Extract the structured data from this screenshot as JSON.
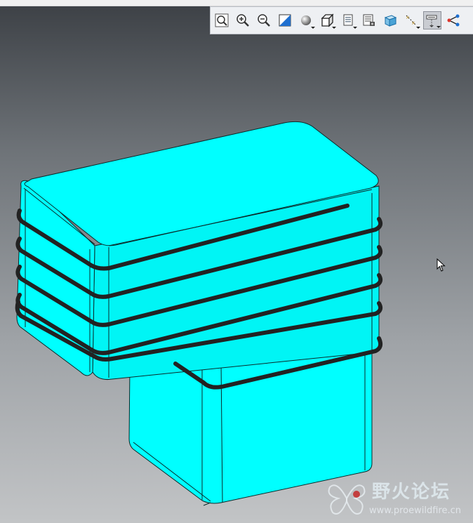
{
  "toolbar": {
    "buttons": [
      {
        "icon": "zoom-fit-icon",
        "active": false,
        "dropdown": false
      },
      {
        "icon": "zoom-in-icon",
        "active": false,
        "dropdown": false
      },
      {
        "icon": "zoom-out-icon",
        "active": false,
        "dropdown": false
      },
      {
        "icon": "repaint-icon",
        "active": false,
        "dropdown": false
      },
      {
        "icon": "shading-icon",
        "active": false,
        "dropdown": true
      },
      {
        "icon": "view-orientation-icon",
        "active": false,
        "dropdown": true
      },
      {
        "icon": "saved-views-icon",
        "active": false,
        "dropdown": true
      },
      {
        "icon": "view-manager-icon",
        "active": false,
        "dropdown": false
      },
      {
        "icon": "perspective-view-icon",
        "active": false,
        "dropdown": false
      },
      {
        "icon": "datum-display-icon",
        "active": false,
        "dropdown": true
      },
      {
        "icon": "annotation-display-icon",
        "active": true,
        "dropdown": true
      },
      {
        "icon": "spin-center-icon",
        "active": false,
        "dropdown": false
      }
    ]
  },
  "model": {
    "color": "#00FFFF",
    "coil_color": "#222222"
  },
  "watermark": {
    "title": "野火论坛",
    "url": "www.proewildfire.cn"
  }
}
